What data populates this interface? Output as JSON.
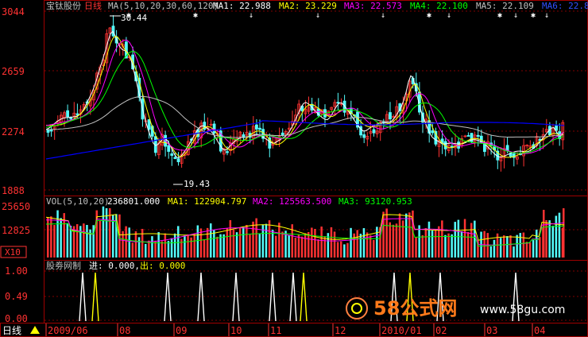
{
  "header": {
    "stock_name": "宝钛股份",
    "period": "日线",
    "ma_label": "MA(5,10,20,30,60,120)",
    "ma1": "MA1: 22.988",
    "ma2": "MA2: 23.229",
    "ma3": "MA3: 22.573",
    "ma4": "MA4: 22.100",
    "ma5": "MA5: 22.109",
    "ma6": "MA6: 22.8"
  },
  "price_axis": [
    "3044",
    "2659",
    "2274",
    "1888"
  ],
  "annotations": {
    "high": "30.44",
    "low": "19.43"
  },
  "volume": {
    "label": "VOL(5,10,20)",
    "value": "236801.000",
    "ma1": "MA1: 122904.797",
    "ma2": "MA2: 125563.500",
    "ma3": "MA3: 93120.953",
    "axis": [
      "25650",
      "12825"
    ],
    "unit": "X10"
  },
  "indicator": {
    "label": "股劵网制",
    "in_label": "进: 0.000,",
    "out_label": "出: 0.000",
    "axis": [
      "1.00",
      "0.49",
      "0.00"
    ]
  },
  "bottom": {
    "period_button": "日线",
    "dates": [
      "2009/06",
      "08",
      "09",
      "10",
      "11",
      "12",
      "2010/01",
      "02",
      "03",
      "04"
    ]
  },
  "watermark": {
    "text": "58公式网",
    "url": "www.58gu.com"
  },
  "colors": {
    "up": "#ff3232",
    "down": "#54fcfc",
    "grid": "#800000",
    "ma1": "#ffffff",
    "ma2": "#ffff00",
    "ma3": "#ff00ff",
    "ma4": "#00ff00",
    "ma5": "#c0c0c0",
    "ma6": "#0000ff"
  }
}
